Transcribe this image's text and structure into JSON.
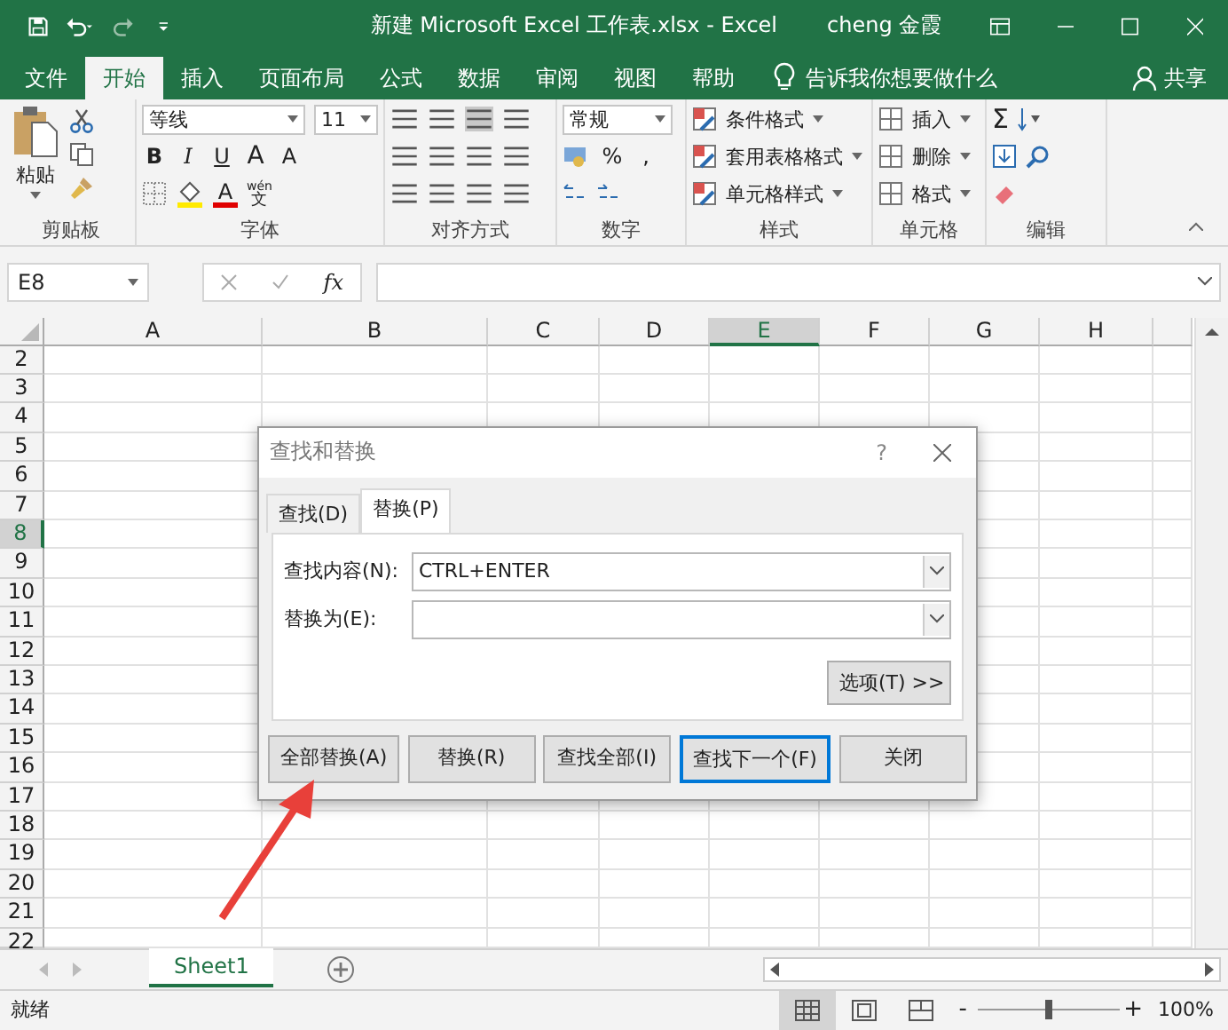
{
  "title_bar": {
    "title": "新建 Microsoft Excel 工作表.xlsx  -  Excel",
    "user": "cheng 金霞"
  },
  "ribbon_tabs": [
    {
      "label": "文件",
      "selected": false
    },
    {
      "label": "开始",
      "selected": true
    },
    {
      "label": "插入",
      "selected": false
    },
    {
      "label": "页面布局",
      "selected": false
    },
    {
      "label": "公式",
      "selected": false
    },
    {
      "label": "数据",
      "selected": false
    },
    {
      "label": "审阅",
      "selected": false
    },
    {
      "label": "视图",
      "selected": false
    },
    {
      "label": "帮助",
      "selected": false
    }
  ],
  "tell_me": "告诉我你想要做什么",
  "share": "共享",
  "clipboard": {
    "paste": "粘贴",
    "label": "剪贴板"
  },
  "font": {
    "name": "等线",
    "size": "11",
    "bold": "B",
    "italic": "I",
    "underline": "U",
    "grow": "A",
    "shrink": "A",
    "font_color": "A",
    "ruby": "wén",
    "base": "文",
    "label": "字体"
  },
  "alignment": {
    "label": "对齐方式"
  },
  "number": {
    "format": "常规",
    "percent": "%",
    "comma": ",",
    "label": "数字"
  },
  "styles": {
    "items": [
      "条件格式",
      "套用表格格式",
      "单元格样式"
    ],
    "label": "样式"
  },
  "cells": {
    "items": [
      "插入",
      "删除",
      "格式"
    ],
    "label": "单元格"
  },
  "editing": {
    "sum": "Σ",
    "label": "编辑"
  },
  "formula_bar": {
    "name_box": "E8",
    "fx": "fx"
  },
  "columns": [
    {
      "label": "A",
      "selected": false
    },
    {
      "label": "B",
      "selected": false
    },
    {
      "label": "C",
      "selected": false
    },
    {
      "label": "D",
      "selected": false
    },
    {
      "label": "E",
      "selected": true
    },
    {
      "label": "F",
      "selected": false
    },
    {
      "label": "G",
      "selected": false
    },
    {
      "label": "H",
      "selected": false
    }
  ],
  "rows": [
    {
      "label": "2",
      "selected": false
    },
    {
      "label": "3",
      "selected": false
    },
    {
      "label": "4",
      "selected": false
    },
    {
      "label": "5",
      "selected": false
    },
    {
      "label": "6",
      "selected": false
    },
    {
      "label": "7",
      "selected": false
    },
    {
      "label": "8",
      "selected": true
    },
    {
      "label": "9",
      "selected": false
    },
    {
      "label": "10",
      "selected": false
    },
    {
      "label": "11",
      "selected": false
    },
    {
      "label": "12",
      "selected": false
    },
    {
      "label": "13",
      "selected": false
    },
    {
      "label": "14",
      "selected": false
    },
    {
      "label": "15",
      "selected": false
    },
    {
      "label": "16",
      "selected": false
    },
    {
      "label": "17",
      "selected": false
    },
    {
      "label": "18",
      "selected": false
    },
    {
      "label": "19",
      "selected": false
    },
    {
      "label": "20",
      "selected": false
    },
    {
      "label": "21",
      "selected": false
    },
    {
      "label": "22",
      "selected": false
    }
  ],
  "dialog": {
    "title": "查找和替换",
    "help": "?",
    "tabs": [
      {
        "label": "查找(D)",
        "selected": false
      },
      {
        "label": "替换(P)",
        "selected": true
      }
    ],
    "fields": [
      {
        "label": "查找内容(N):",
        "value": "CTRL+ENTER"
      },
      {
        "label": "替换为(E):"
      }
    ],
    "options": "选项(T) >>",
    "buttons": [
      {
        "label": "全部替换(A)",
        "focused": false
      },
      {
        "label": "替换(R)",
        "focused": false
      },
      {
        "label": "查找全部(I)",
        "focused": false
      },
      {
        "label": "查找下一个(F)",
        "focused": true
      },
      {
        "label": "关闭",
        "focused": false
      }
    ]
  },
  "sheet_tabs": [
    {
      "label": "Sheet1",
      "selected": true
    }
  ],
  "status_bar": {
    "status": "就绪",
    "views": [
      {
        "kind": "normal",
        "selected": true
      },
      {
        "kind": "page_layout",
        "selected": false
      },
      {
        "kind": "page_break",
        "selected": false
      }
    ],
    "zoom_out": "-",
    "zoom_in": "+",
    "zoom": "100%",
    "zoom_slider": {
      "level": 0.5
    }
  }
}
